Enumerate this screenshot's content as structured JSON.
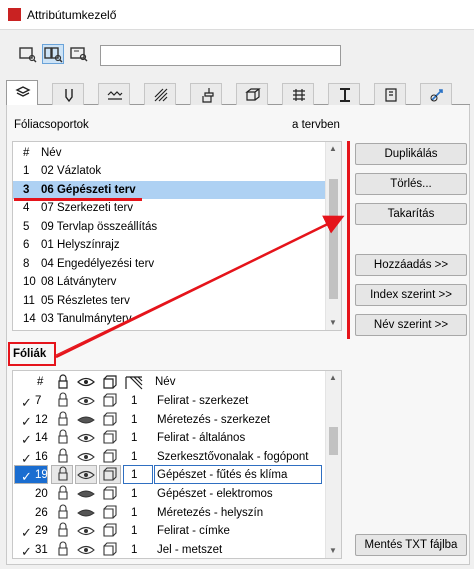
{
  "window": {
    "title": "Attribútumkezelő"
  },
  "search": {
    "value": "",
    "placeholder": ""
  },
  "tabs": [
    {
      "icon": "layers-icon",
      "active": true
    },
    {
      "icon": "pen-icon"
    },
    {
      "icon": "line-type-icon"
    },
    {
      "icon": "fill-icon"
    },
    {
      "icon": "paint-icon"
    },
    {
      "icon": "composite-icon"
    },
    {
      "icon": "surface-icon"
    },
    {
      "icon": "profile-icon"
    },
    {
      "icon": "zone-icon"
    },
    {
      "icon": "material-icon"
    }
  ],
  "layer_groups": {
    "title": "Fóliacsoportok",
    "scope": "a tervben",
    "headers": {
      "num": "#",
      "name": "Név"
    },
    "rows": [
      {
        "num": "1",
        "name": "02 Vázlatok"
      },
      {
        "num": "3",
        "name": "06 Gépészeti terv",
        "selected": true
      },
      {
        "num": "4",
        "name": "07 Szerkezeti terv"
      },
      {
        "num": "5",
        "name": "09 Tervlap összeállítás"
      },
      {
        "num": "6",
        "name": "01 Helyszínrajz"
      },
      {
        "num": "8",
        "name": "04 Engedélyezési terv"
      },
      {
        "num": "10",
        "name": "08 Látványterv"
      },
      {
        "num": "11",
        "name": "05 Részletes terv"
      },
      {
        "num": "14",
        "name": "03 Tanulmányterv"
      }
    ]
  },
  "buttons": {
    "duplicate": "Duplikálás",
    "delete": "Törlés...",
    "purge": "Takarítás",
    "add": "Hozzáadás >>",
    "by_index": "Index szerint >>",
    "by_name": "Név szerint >>",
    "save_txt": "Mentés TXT fájlba"
  },
  "layers": {
    "title": "Fóliák",
    "headers": {
      "num": "#",
      "name": "Név"
    },
    "rows": [
      {
        "check": "✓",
        "num": "7",
        "int": "1",
        "name": "Felirat - szerkezet",
        "hidden": false
      },
      {
        "check": "✓",
        "num": "12",
        "int": "1",
        "name": "Méretezés - szerkezet",
        "hidden": true
      },
      {
        "check": "✓",
        "num": "14",
        "int": "1",
        "name": "Felirat - általános",
        "hidden": false
      },
      {
        "check": "✓",
        "num": "16",
        "int": "1",
        "name": "Szerkesztővonalak - fogópont",
        "hidden": false
      },
      {
        "check": "✓",
        "num": "19",
        "int": "1",
        "name": "Gépészet - fűtés és klíma",
        "selected": true,
        "hidden": false
      },
      {
        "check": "",
        "num": "20",
        "int": "1",
        "name": "Gépészet - elektromos",
        "hidden": true
      },
      {
        "check": "",
        "num": "26",
        "int": "1",
        "name": "Méretezés - helyszín",
        "hidden": true
      },
      {
        "check": "✓",
        "num": "29",
        "int": "1",
        "name": "Felirat - címke",
        "hidden": false
      },
      {
        "check": "✓",
        "num": "31",
        "int": "1",
        "name": "Jel - metszet",
        "hidden": false
      }
    ]
  }
}
